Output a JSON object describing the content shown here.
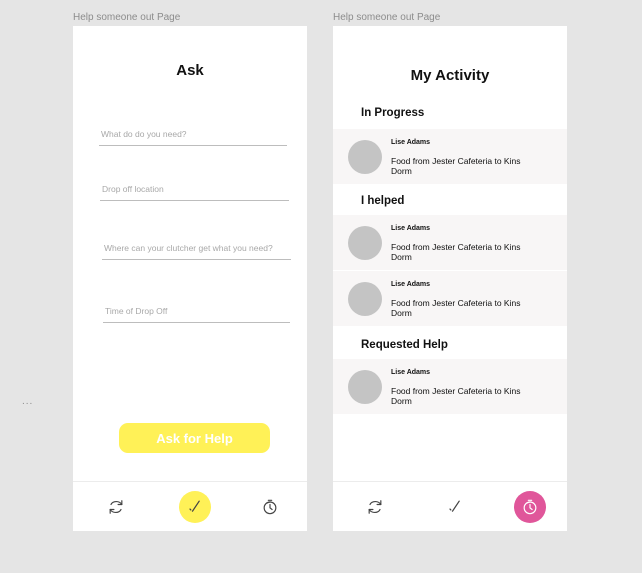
{
  "canvas": {
    "frame_labels": [
      "Help someone out Page",
      "Help someone out Page"
    ],
    "ellipsis": "..."
  },
  "ask_screen": {
    "title": "Ask",
    "fields": [
      {
        "placeholder": "What do do you need?"
      },
      {
        "placeholder": "Drop off location"
      },
      {
        "placeholder": "Where can your clutcher get what you need?"
      },
      {
        "placeholder": "Time of Drop Off"
      }
    ],
    "submit_label": "Ask for Help"
  },
  "activity_screen": {
    "title": "My Activity",
    "sections": [
      {
        "header": "In Progress",
        "items": [
          {
            "name": "Lise Adams",
            "description": "Food from Jester Cafeteria to Kins Dorm"
          }
        ]
      },
      {
        "header": "I helped",
        "items": [
          {
            "name": "Lise Adams",
            "description": "Food from Jester Cafeteria to Kins Dorm"
          },
          {
            "name": "Lise Adams",
            "description": "Food from Jester Cafeteria to Kins Dorm"
          }
        ]
      },
      {
        "header": "Requested Help",
        "items": [
          {
            "name": "Lise Adams",
            "description": "Food from Jester Cafeteria to Kins Dorm"
          }
        ]
      }
    ]
  },
  "nav": {
    "icons": [
      "swap-icon",
      "pencil-icon",
      "timer-icon"
    ],
    "ask_active_color": "#fff157",
    "activity_active_color": "#e0569a"
  }
}
